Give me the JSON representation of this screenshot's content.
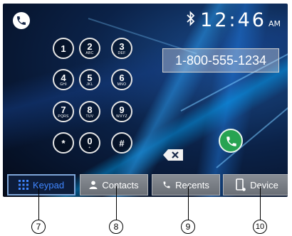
{
  "status": {
    "time": "12:46",
    "ampm": "AM"
  },
  "dialed_number": "1-800-555-1234",
  "keypad": [
    {
      "digit": "1",
      "letters": ""
    },
    {
      "digit": "2",
      "letters": "ABC"
    },
    {
      "digit": "3",
      "letters": "DEF"
    },
    {
      "digit": "4",
      "letters": "GHI"
    },
    {
      "digit": "5",
      "letters": "JKL"
    },
    {
      "digit": "6",
      "letters": "MNO"
    },
    {
      "digit": "7",
      "letters": "PQRS"
    },
    {
      "digit": "8",
      "letters": "TUV"
    },
    {
      "digit": "9",
      "letters": "WXYZ"
    },
    {
      "digit": "*",
      "letters": ""
    },
    {
      "digit": "0",
      "letters": "+"
    },
    {
      "digit": "#",
      "letters": ""
    }
  ],
  "tabs": [
    {
      "label": "Keypad",
      "icon": "keypad-grid-icon",
      "active": true
    },
    {
      "label": "Contacts",
      "icon": "person-icon",
      "active": false
    },
    {
      "label": "Recents",
      "icon": "phone-handset-icon",
      "active": false
    },
    {
      "label": "Device",
      "icon": "mobile-device-icon",
      "active": false
    }
  ],
  "callouts": [
    "7",
    "8",
    "9",
    "10"
  ],
  "colors": {
    "call_green": "#27a352",
    "active_tab_text": "#3f86ff",
    "background": "#0b2248"
  }
}
